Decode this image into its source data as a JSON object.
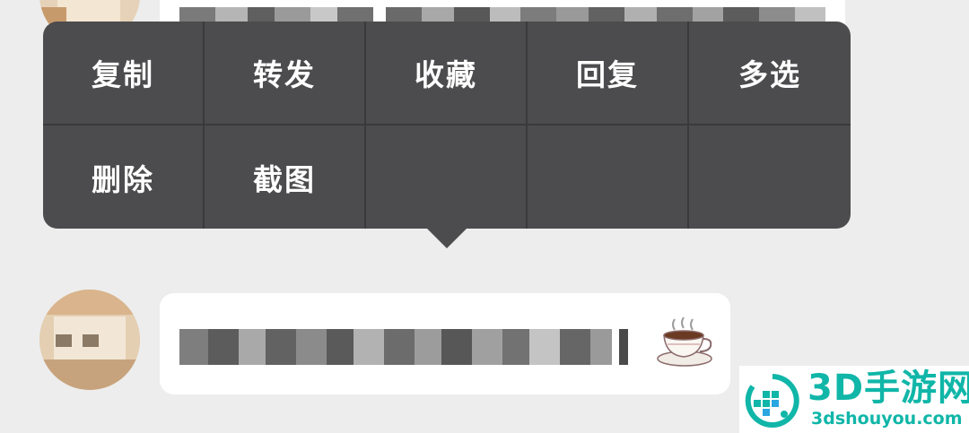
{
  "context_menu": {
    "items": [
      {
        "label": "复制"
      },
      {
        "label": "转发"
      },
      {
        "label": "收藏"
      },
      {
        "label": "回复"
      },
      {
        "label": "多选"
      },
      {
        "label": "删除"
      },
      {
        "label": "截图"
      }
    ]
  },
  "messages": [
    {
      "icons": {
        "avatar": "avatar-image",
        "content": "pixelated-text"
      }
    },
    {
      "icons": {
        "avatar": "avatar-image",
        "content": "pixelated-text",
        "emoji": "teacup-emoji"
      }
    }
  ],
  "watermark": {
    "title": "3D手游网",
    "url": "3dshouyou.com",
    "color": "#10b6a8"
  },
  "colors": {
    "background": "#ededed",
    "menu": "#4c4c4e",
    "menu_divider": "#3a3a3c",
    "bubble": "#ffffff"
  }
}
